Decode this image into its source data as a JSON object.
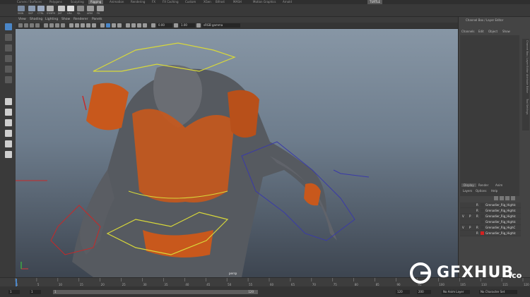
{
  "shelf_tabs": {
    "items": [
      "Curves / Surfaces",
      "Polygons",
      "Sculpting",
      "Rigging",
      "Animation",
      "Rendering",
      "FX",
      "FX Caching",
      "Custom",
      "XGen",
      "Bifrost",
      "MASH",
      "Motion Graphics",
      "Arnold",
      "TURTLE"
    ],
    "active": "Rigging"
  },
  "shelf": {
    "labels": [
      "SKIN",
      "SKP",
      "CTRL",
      "SYMPH",
      "JNT",
      "LRA",
      "SJL",
      "ARM",
      "FK",
      "IK",
      "SEL",
      "JOINT"
    ]
  },
  "viewport_menu": {
    "items": [
      "View",
      "Shading",
      "Lighting",
      "Show",
      "Renderer",
      "Panels"
    ]
  },
  "viewport_toolbar": {
    "exposure": "0.00",
    "gamma": "1.00",
    "colorspace": "sRGB gamma"
  },
  "viewport": {
    "camera_label": "persp"
  },
  "channel_box": {
    "title": "Channel Box / Layer Editor",
    "menu": [
      "Channels",
      "Edit",
      "Object",
      "Show"
    ],
    "side_tabs": [
      "Channel Box / Layer Editor",
      "Attribute Editor",
      "Tool Settings",
      "Modeling Toolkit"
    ]
  },
  "layer_editor": {
    "tabs": [
      "Display",
      "Render",
      "Anim"
    ],
    "active_tab": "Display",
    "menu": [
      "Layers",
      "Options",
      "Help"
    ],
    "layers": [
      {
        "v": "",
        "p": "",
        "r": "R",
        "name": "Grenadier_Rig_HighIc",
        "color": "#3a3a3a"
      },
      {
        "v": "",
        "p": "",
        "r": "R",
        "name": "Grenadier_Rig_HighIc",
        "color": "#3a3a3a"
      },
      {
        "v": "V",
        "p": "P",
        "r": "R",
        "name": "Grenadier_Rig_HighIc",
        "color": "#3a3a3a"
      },
      {
        "v": "",
        "p": "",
        "r": "",
        "name": "Grenadier_Rig_HighIc",
        "color": "#3a3a3a"
      },
      {
        "v": "V",
        "p": "P",
        "r": "R",
        "name": "Grenadier_Rig_HighC",
        "color": "#3a3a3a"
      },
      {
        "v": "",
        "p": "",
        "r": "R",
        "name": "Grenadier_Rig_HighIc",
        "color": "#d42020"
      }
    ]
  },
  "time_slider": {
    "ticks": [
      "1",
      "5",
      "10",
      "15",
      "20",
      "25",
      "30",
      "35",
      "40",
      "45",
      "50",
      "55",
      "60",
      "65",
      "70",
      "75",
      "80",
      "85",
      "90",
      "95",
      "100",
      "105",
      "110",
      "115",
      "120"
    ],
    "current_frame": "1"
  },
  "range_slider": {
    "start": "1",
    "range_start": "1",
    "range_handle_left": "1",
    "range_handle_right": "120",
    "range_end": "120",
    "end": "200",
    "anim_layer": "No Anim Layer",
    "char_set": "No Character Set"
  },
  "watermark": {
    "text": "GFXHUB",
    "suffix": ".co"
  },
  "colors": {
    "viewport_top": "#8796a5",
    "viewport_bottom": "#3d4550",
    "armor_orange": "#c8581c",
    "rig_yellow": "#d8d83a",
    "rig_blue": "#3a3aa8",
    "rig_red": "#c82828",
    "selected_tool": "#4a86c8"
  }
}
